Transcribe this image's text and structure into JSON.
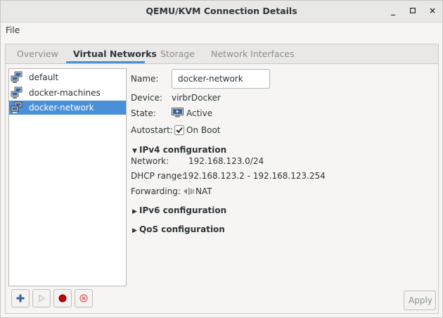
{
  "window": {
    "title": "QEMU/KVM Connection Details",
    "controls": {
      "minimize": "_",
      "maximize": "□",
      "close": "×"
    }
  },
  "menubar": {
    "file": "File"
  },
  "tabs": [
    {
      "label": "Overview",
      "active": false
    },
    {
      "label": "Virtual Networks",
      "active": true
    },
    {
      "label": "Storage",
      "active": false
    },
    {
      "label": "Network Interfaces",
      "active": false
    }
  ],
  "networks": [
    {
      "label": "default",
      "selected": false,
      "icon": "network-icon"
    },
    {
      "label": "docker-machines",
      "selected": false,
      "icon": "network-icon"
    },
    {
      "label": "docker-network",
      "selected": true,
      "icon": "network-icon"
    }
  ],
  "list_buttons": {
    "add": "add-network-icon",
    "start": "start-network-icon",
    "stop": "stop-network-icon",
    "delete": "delete-network-icon"
  },
  "details": {
    "name_label": "Name:",
    "name_value": "docker-network",
    "device_label": "Device:",
    "device_value": "virbrDocker",
    "state_label": "State:",
    "state_value": "Active",
    "autostart_label": "Autostart:",
    "autostart_value": "On Boot",
    "autostart_checked": true,
    "ipv4": {
      "header": "IPv4 configuration",
      "expanded": true,
      "network_label": "Network:",
      "network_value": "192.168.123.0/24",
      "dhcp_label": "DHCP range:",
      "dhcp_value": "192.168.123.2 - 192.168.123.254",
      "forwarding_label": "Forwarding:",
      "forwarding_value": "NAT"
    },
    "ipv6_header": "IPv6 configuration",
    "qos_header": "QoS configuration"
  },
  "apply_label": "Apply",
  "colors": {
    "accent": "#4a90d9",
    "stop_red": "#cc0000",
    "add_blue": "#3465a4",
    "disabled": "#8b8e8f"
  }
}
